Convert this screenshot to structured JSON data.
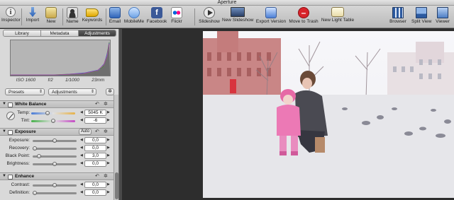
{
  "window": {
    "title": "Aperture"
  },
  "toolbar": {
    "items": [
      {
        "label": "Inspector"
      },
      {
        "label": "Import"
      },
      {
        "label": "New"
      },
      {
        "label": "Name"
      },
      {
        "label": "Keywords"
      },
      {
        "label": "Email"
      },
      {
        "label": "MobileMe"
      },
      {
        "label": "Facebook"
      },
      {
        "label": "Flickr"
      },
      {
        "label": "Slideshow"
      },
      {
        "label": "New Slideshow"
      },
      {
        "label": "Export Version"
      },
      {
        "label": "Move to Trash"
      },
      {
        "label": "New Light Table"
      },
      {
        "label": "Browser"
      },
      {
        "label": "Split View"
      },
      {
        "label": "Viewer"
      }
    ]
  },
  "inspector": {
    "tabs": [
      "Library",
      "Metadata",
      "Adjustments"
    ],
    "active_tab": "Adjustments",
    "exif": {
      "iso": "ISO 1600",
      "aperture": "f/2",
      "shutter": "1/1000",
      "focal": "23mm"
    },
    "presets_label": "Presets",
    "adjustments_label": "Adjustments",
    "white_balance": {
      "title": "White Balance",
      "temp_label": "Temp:",
      "temp_value": "5045 K",
      "tint_label": "Tint:",
      "tint_value": "-6"
    },
    "exposure": {
      "title": "Exposure",
      "auto_label": "Auto",
      "rows": [
        {
          "label": "Exposure:",
          "value": "0,0"
        },
        {
          "label": "Recovery:",
          "value": "0,0"
        },
        {
          "label": "Black Point:",
          "value": "3,0"
        },
        {
          "label": "Brightness:",
          "value": "0,0"
        }
      ]
    },
    "enhance": {
      "title": "Enhance",
      "rows": [
        {
          "label": "Contrast:",
          "value": "0,0"
        },
        {
          "label": "Definition:",
          "value": "0,0"
        }
      ]
    }
  }
}
